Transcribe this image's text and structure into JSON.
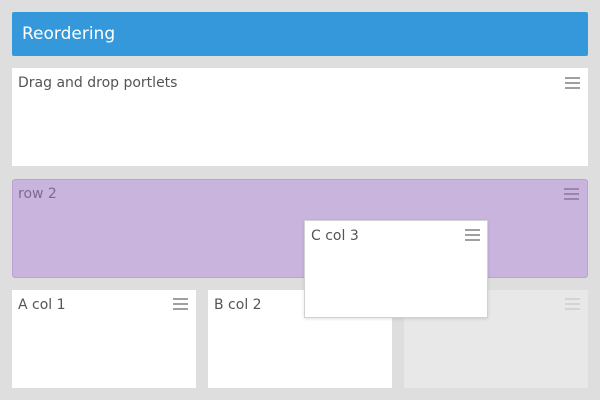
{
  "header": {
    "title": "Reordering"
  },
  "portlets": {
    "top": {
      "title": "Drag and drop portlets"
    },
    "row2": {
      "title": "row 2"
    },
    "col1": {
      "title": "A col 1"
    },
    "col2": {
      "title": "B col 2"
    },
    "dragging": {
      "title": "C col 3"
    }
  },
  "colors": {
    "header_bg": "#3498db",
    "highlight_row_bg": "#c9b4de",
    "page_bg": "#dedede",
    "portlet_bg": "#ffffff",
    "placeholder_bg": "#e8e8e8"
  },
  "icons": {
    "portlet_menu": "hamburger-menu-icon"
  }
}
